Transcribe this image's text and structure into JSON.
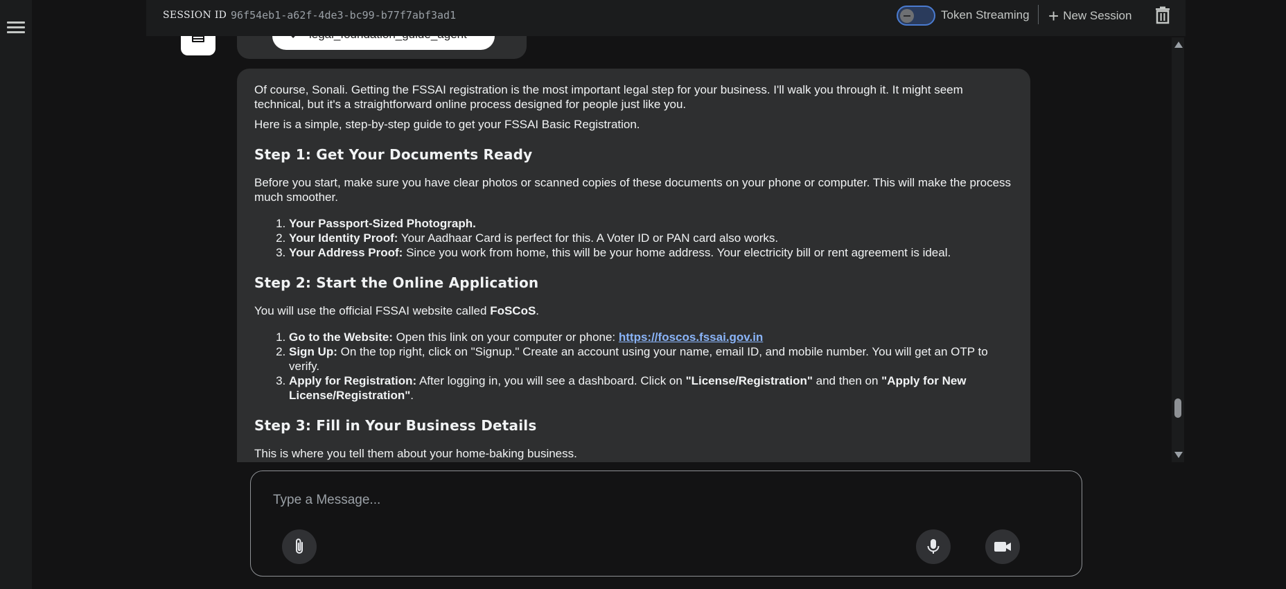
{
  "header": {
    "session_label": "SESSION ID",
    "session_id": "96f54eb1-a62f-4de3-bc99-b77f7abf3ad1",
    "token_streaming_label": "Token Streaming",
    "token_streaming_enabled": false,
    "new_session_label": "New Session"
  },
  "tool_call": {
    "label": "legal_foundation_guide_agent"
  },
  "message": {
    "intro_1": "Of course, Sonali. Getting the FSSAI registration is the most important legal step for your business. I'll walk you through it. It might seem technical, but it's a straightforward online process designed for people just like you.",
    "intro_2": "Here is a simple, step-by-step guide to get your FSSAI Basic Registration.",
    "step1_heading": "Step 1: Get Your Documents Ready",
    "step1_text": "Before you start, make sure you have clear photos or scanned copies of these documents on your phone or computer. This will make the process much smoother.",
    "step1_items": [
      {
        "bold": "Your Passport-Sized Photograph.",
        "text": ""
      },
      {
        "bold": "Your Identity Proof:",
        "text": " Your Aadhaar Card is perfect for this. A Voter ID or PAN card also works."
      },
      {
        "bold": "Your Address Proof:",
        "text": " Since you work from home, this will be your home address. Your electricity bill or rent agreement is ideal."
      }
    ],
    "step2_heading": "Step 2: Start the Online Application",
    "step2_text_pre": "You will use the official FSSAI website called ",
    "step2_text_bold": "FoSCoS",
    "step2_text_post": ".",
    "step2_item1_bold": "Go to the Website:",
    "step2_item1_text": " Open this link on your computer or phone: ",
    "step2_item1_link": "https://foscos.fssai.gov.in",
    "step2_item2_bold": "Sign Up:",
    "step2_item2_text": " On the top right, click on \"Signup.\" Create an account using your name, email ID, and mobile number. You will get an OTP to verify.",
    "step2_item3_bold": "Apply for Registration:",
    "step2_item3_text_a": " After logging in, you will see a dashboard. Click on ",
    "step2_item3_bold_b": "\"License/Registration\"",
    "step2_item3_text_c": " and then on ",
    "step2_item3_bold_d": "\"Apply for New License/Registration\"",
    "step2_item3_text_e": ".",
    "step3_heading": "Step 3: Fill in Your Business Details",
    "step3_text": "This is where you tell them about your home-baking business."
  },
  "composer": {
    "placeholder": "Type a Message..."
  },
  "icons": {
    "menu": "hamburger-menu-icon",
    "trash": "trash-icon",
    "attach": "paperclip-icon",
    "mic": "microphone-icon",
    "video": "video-camera-icon"
  }
}
